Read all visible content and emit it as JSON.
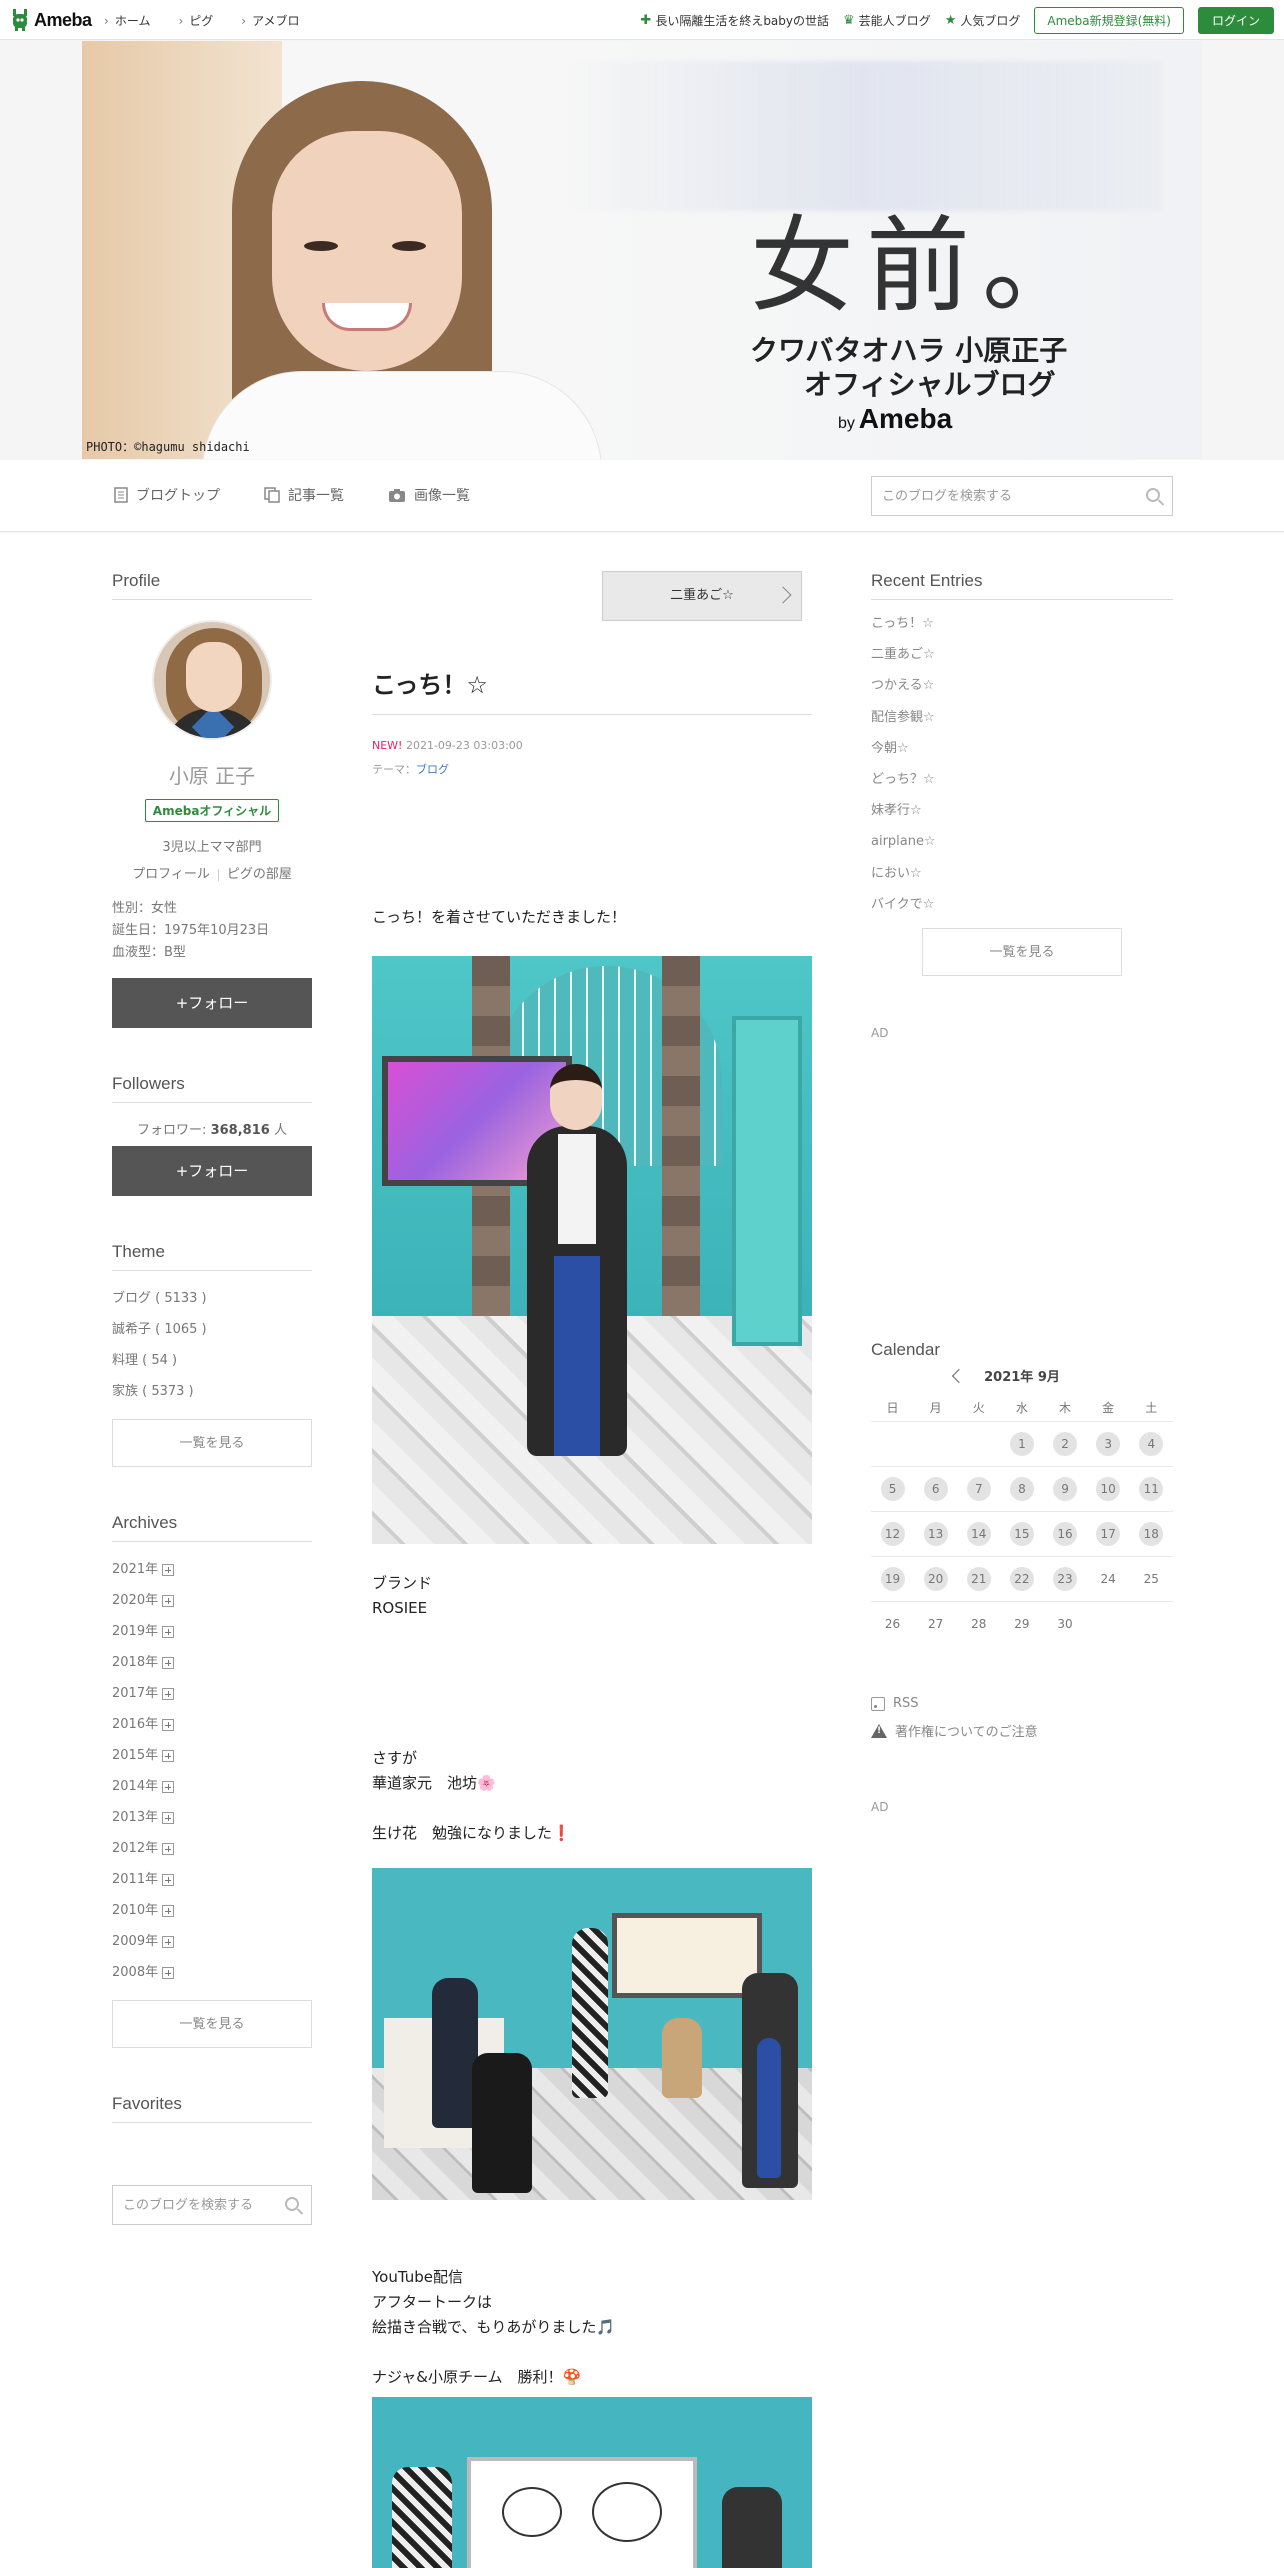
{
  "topbar": {
    "logo": "Ameba",
    "nav": [
      "ホーム",
      "ピグ",
      "アメブロ"
    ],
    "links": [
      "長い隔離生活を終えbabyの世話",
      "芸能人ブログ",
      "人気ブログ"
    ],
    "register_label": "Ameba新規登録(無料)",
    "login_label": "ログイン"
  },
  "banner": {
    "title": "女前。",
    "subtitle1": "クワバタオハラ 小原正子",
    "subtitle2": "オフィシャルブログ",
    "by": "by",
    "brand": "Ameba",
    "photo_credit": "PHOTO：©hagumu shidachi"
  },
  "blognav": {
    "tabs": [
      "ブログトップ",
      "記事一覧",
      "画像一覧"
    ],
    "search_placeholder": "このブログを検索する"
  },
  "profile": {
    "section_title": "Profile",
    "name": "小原 正子",
    "badge": "Amebaオフィシャル",
    "tagline": "3児以上ママ部門",
    "link_profile": "プロフィール",
    "link_room": "ピグの部屋",
    "gender": "性別：女性",
    "birthday": "誕生日：1975年10月23日",
    "blood": "血液型：B型",
    "follow_label": "+フォロー"
  },
  "followers": {
    "section_title": "Followers",
    "count_label": "フォロワー:",
    "count": "368,816",
    "unit": "人",
    "follow_label": "+フォロー"
  },
  "theme": {
    "section_title": "Theme",
    "items": [
      "ブログ ( 5133 )",
      "誠希子 ( 1065 )",
      "料理 ( 54 )",
      "家族 ( 5373 )"
    ],
    "more_label": "一覧を見る"
  },
  "archives": {
    "section_title": "Archives",
    "items": [
      "2021年",
      "2020年",
      "2019年",
      "2018年",
      "2017年",
      "2016年",
      "2015年",
      "2014年",
      "2013年",
      "2012年",
      "2011年",
      "2010年",
      "2009年",
      "2008年"
    ],
    "more_label": "一覧を見る"
  },
  "favorites": {
    "section_title": "Favorites",
    "search_placeholder": "このブログを検索する"
  },
  "article": {
    "prev_label": "二重あご☆",
    "title": "こっち！☆",
    "new_label": "NEW!",
    "date": "2021-09-23 03:03:00",
    "theme_label": "テーマ：",
    "theme_link": "ブログ",
    "p1": "こっち！を着させていただきました！",
    "p2_line1": "ブランド",
    "p2_line2": "ROSIEE",
    "p3_line1": "さすが",
    "p3_line2": "華道家元　池坊🌸",
    "p4": "生け花　勉強になりました❗",
    "p5_line1": "YouTube配信",
    "p5_line2": "アフタートークは",
    "p5_line3": "絵描き合戦で、もりあがりました🎵",
    "p6": "ナジャ&小原チーム　勝利！🍄"
  },
  "recent": {
    "section_title": "Recent Entries",
    "items": [
      "こっち！☆",
      "二重あご☆",
      "つかえる☆",
      "配信参観☆",
      "今朝☆",
      "どっち？☆",
      "妹孝行☆",
      "airplane☆",
      "におい☆",
      "バイクで☆"
    ],
    "more_label": "一覧を見る"
  },
  "ads": {
    "label1": "AD",
    "label2": "AD"
  },
  "calendar": {
    "section_title": "Calendar",
    "month": "2021年 9月",
    "weekdays": [
      "日",
      "月",
      "火",
      "水",
      "木",
      "金",
      "土"
    ],
    "weeks": [
      [
        "",
        "",
        "",
        "1",
        "2",
        "3",
        "4"
      ],
      [
        "5",
        "6",
        "7",
        "8",
        "9",
        "10",
        "11"
      ],
      [
        "12",
        "13",
        "14",
        "15",
        "16",
        "17",
        "18"
      ],
      [
        "19",
        "20",
        "21",
        "22",
        "23",
        "24",
        "25"
      ],
      [
        "26",
        "27",
        "28",
        "29",
        "30",
        "",
        ""
      ]
    ],
    "posted_days": [
      "1",
      "2",
      "3",
      "4",
      "5",
      "6",
      "7",
      "8",
      "9",
      "10",
      "11",
      "12",
      "13",
      "14",
      "15",
      "16",
      "17",
      "18",
      "19",
      "20",
      "21",
      "22",
      "23"
    ]
  },
  "footer_links": {
    "rss": "RSS",
    "copyright": "著作権についてのご注意"
  }
}
